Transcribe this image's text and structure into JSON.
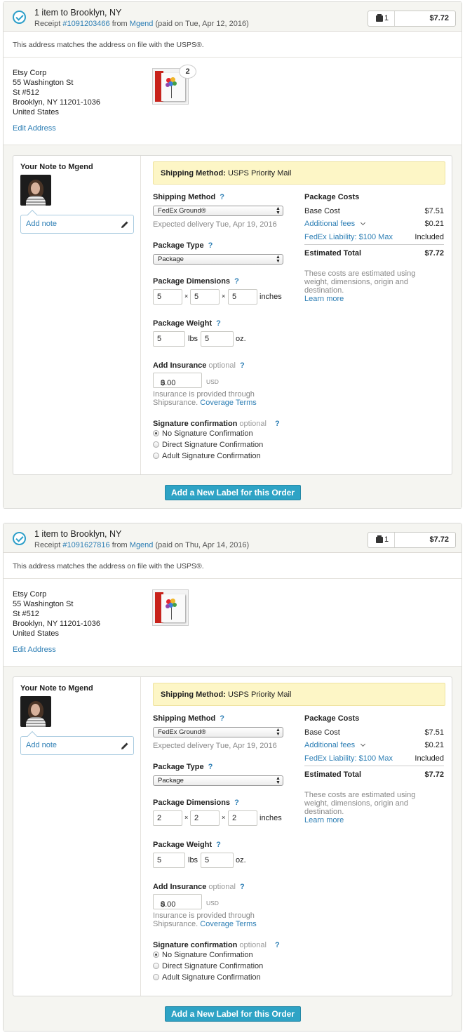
{
  "orders": [
    {
      "title": "1 item to Brooklyn, NY",
      "receipt_prefix": "Receipt",
      "receipt_number": "#1091203466",
      "from_word": "from",
      "seller": "Mgend",
      "paid_text": "(paid on Tue, Apr 12, 2016)",
      "label_count": "1",
      "label_price": "$7.72",
      "address_match": "This address matches the address on file with the USPS®.",
      "address_lines": [
        "Etsy Corp",
        "55 Washington St",
        "St #512",
        "Brooklyn, NY 11201-1036",
        "United States"
      ],
      "edit_address": "Edit Address",
      "item_quantity": "2",
      "note_title": "Your Note to Mgend",
      "add_note": "Add note",
      "banner_label": "Shipping Method:",
      "banner_value": "USPS Priority Mail",
      "shipping_method_label": "Shipping Method",
      "shipping_method_value": "FedEx Ground®",
      "expected_delivery": "Expected delivery Tue, Apr 19, 2016",
      "package_type_label": "Package Type",
      "package_type_value": "Package",
      "dimensions_label": "Package Dimensions",
      "dim_length": "5",
      "dim_width": "5",
      "dim_height": "5",
      "dim_times": "×",
      "dim_unit": "inches",
      "weight_label": "Package Weight",
      "weight_lbs": "5",
      "weight_lbs_unit": "lbs",
      "weight_oz": "5",
      "weight_oz_unit": "oz.",
      "insurance_label": "Add Insurance",
      "optional": "optional",
      "help": "?",
      "insurance_currency": "$",
      "insurance_value": "0.00",
      "insurance_unit": "USD",
      "insurance_note_1": "Insurance is provided through",
      "insurance_note_2": "Shipsurance.",
      "coverage_terms": "Coverage Terms",
      "signature_label": "Signature confirmation",
      "signature_options": [
        "No Signature Confirmation",
        "Direct Signature Confirmation",
        "Adult Signature Confirmation"
      ],
      "signature_selected": 0,
      "costs_title": "Package Costs",
      "base_cost_label": "Base Cost",
      "base_cost": "$7.51",
      "additional_fees_label": "Additional fees",
      "additional_fees": "$0.21",
      "liability_label": "FedEx Liability: $100 Max",
      "liability_value": "Included",
      "estimated_total_label": "Estimated Total",
      "estimated_total": "$7.72",
      "estimate_note": "These costs are estimated using weight, dimensions, origin and destination.",
      "learn_more": "Learn more",
      "add_label_button": "Add a New Label for this Order"
    },
    {
      "title": "1 item to Brooklyn, NY",
      "receipt_prefix": "Receipt",
      "receipt_number": "#1091627816",
      "from_word": "from",
      "seller": "Mgend",
      "paid_text": "(paid on Thu, Apr 14, 2016)",
      "label_count": "1",
      "label_price": "$7.72",
      "address_match": "This address matches the address on file with the USPS®.",
      "address_lines": [
        "Etsy Corp",
        "55 Washington St",
        "St #512",
        "Brooklyn, NY 11201-1036",
        "United States"
      ],
      "edit_address": "Edit Address",
      "item_quantity": "",
      "note_title": "Your Note to Mgend",
      "add_note": "Add note",
      "banner_label": "Shipping Method:",
      "banner_value": "USPS Priority Mail",
      "shipping_method_label": "Shipping Method",
      "shipping_method_value": "FedEx Ground®",
      "expected_delivery": "Expected delivery Tue, Apr 19, 2016",
      "package_type_label": "Package Type",
      "package_type_value": "Package",
      "dimensions_label": "Package Dimensions",
      "dim_length": "2",
      "dim_width": "2",
      "dim_height": "2",
      "dim_times": "×",
      "dim_unit": "inches",
      "weight_label": "Package Weight",
      "weight_lbs": "5",
      "weight_lbs_unit": "lbs",
      "weight_oz": "5",
      "weight_oz_unit": "oz.",
      "insurance_label": "Add Insurance",
      "optional": "optional",
      "help": "?",
      "insurance_currency": "$",
      "insurance_value": "0.00",
      "insurance_unit": "USD",
      "insurance_note_1": "Insurance is provided through",
      "insurance_note_2": "Shipsurance.",
      "coverage_terms": "Coverage Terms",
      "signature_label": "Signature confirmation",
      "signature_options": [
        "No Signature Confirmation",
        "Direct Signature Confirmation",
        "Adult Signature Confirmation"
      ],
      "signature_selected": 0,
      "costs_title": "Package Costs",
      "base_cost_label": "Base Cost",
      "base_cost": "$7.51",
      "additional_fees_label": "Additional fees",
      "additional_fees": "$0.21",
      "liability_label": "FedEx Liability: $100 Max",
      "liability_value": "Included",
      "estimated_total_label": "Estimated Total",
      "estimated_total": "$7.72",
      "estimate_note": "These costs are estimated using weight, dimensions, origin and destination.",
      "learn_more": "Learn more",
      "add_label_button": "Add a New Label for this Order"
    }
  ],
  "colors": {
    "accent": "#2ea3c5",
    "link": "#2e7fb5",
    "banner": "#fdf6c6"
  },
  "icons": [
    "check-circle-icon",
    "box-icon",
    "pencil-icon",
    "chevron-down-icon",
    "select-arrows-icon"
  ]
}
